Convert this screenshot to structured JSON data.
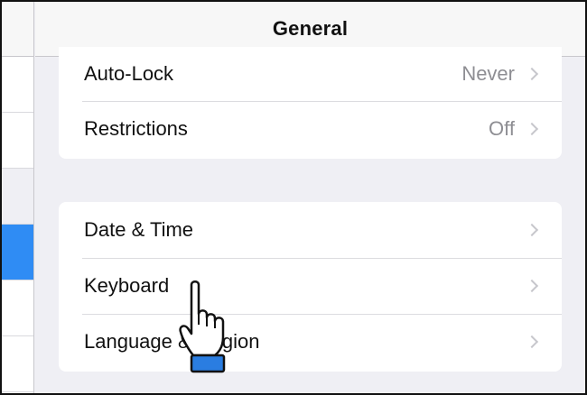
{
  "nav": {
    "title": "General"
  },
  "group1": [
    {
      "label": "Auto-Lock",
      "value": "Never"
    },
    {
      "label": "Restrictions",
      "value": "Off"
    }
  ],
  "group2": [
    {
      "label": "Date & Time"
    },
    {
      "label": "Keyboard"
    },
    {
      "label": "Language & Region"
    }
  ],
  "colors": {
    "selection": "#2f8cf4",
    "background": "#efeff4",
    "chevron": "#c7c7cc",
    "cursor_cuff": "#2a7de1"
  },
  "icons": [
    "chevron-right-icon",
    "hand-pointer-icon"
  ]
}
